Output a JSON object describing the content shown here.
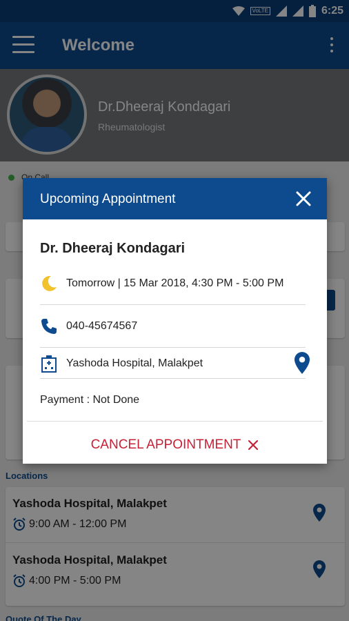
{
  "status_bar": {
    "network_badge": "VoLTE",
    "time": "6:25"
  },
  "app_bar": {
    "title": "Welcome"
  },
  "profile": {
    "name": "Dr.Dheeraj Kondagari",
    "specialty": "Rheumatologist"
  },
  "status": {
    "label": "On Call",
    "color": "#46b34a"
  },
  "locations": {
    "heading": "Locations",
    "items": [
      {
        "name": "Yashoda Hospital, Malakpet",
        "time": "9:00 AM - 12:00 PM"
      },
      {
        "name": "Yashoda Hospital, Malakpet",
        "time": "4:00 PM - 5:00 PM"
      }
    ]
  },
  "quote_heading": "Quote Of The Day",
  "dialog": {
    "title": "Upcoming Appointment",
    "doctor": "Dr. Dheeraj Kondagari",
    "datetime": "Tomorrow | 15 Mar 2018, 4:30 PM - 5:00 PM",
    "phone": "040-45674567",
    "hospital": "Yashoda Hospital, Malakpet",
    "payment": "Payment : Not Done",
    "cancel_label": "CANCEL APPOINTMENT",
    "icons": {
      "datetime": "moon-icon",
      "phone": "phone-icon",
      "hospital": "hospital-icon",
      "map": "location-pin-icon",
      "close": "close-icon",
      "cancel": "cancel-x-icon"
    }
  },
  "colors": {
    "primary": "#0d4b8e",
    "status_bar": "#0b3f7a",
    "accent_yellow": "#f2c12e",
    "cancel_red": "#c62035"
  }
}
